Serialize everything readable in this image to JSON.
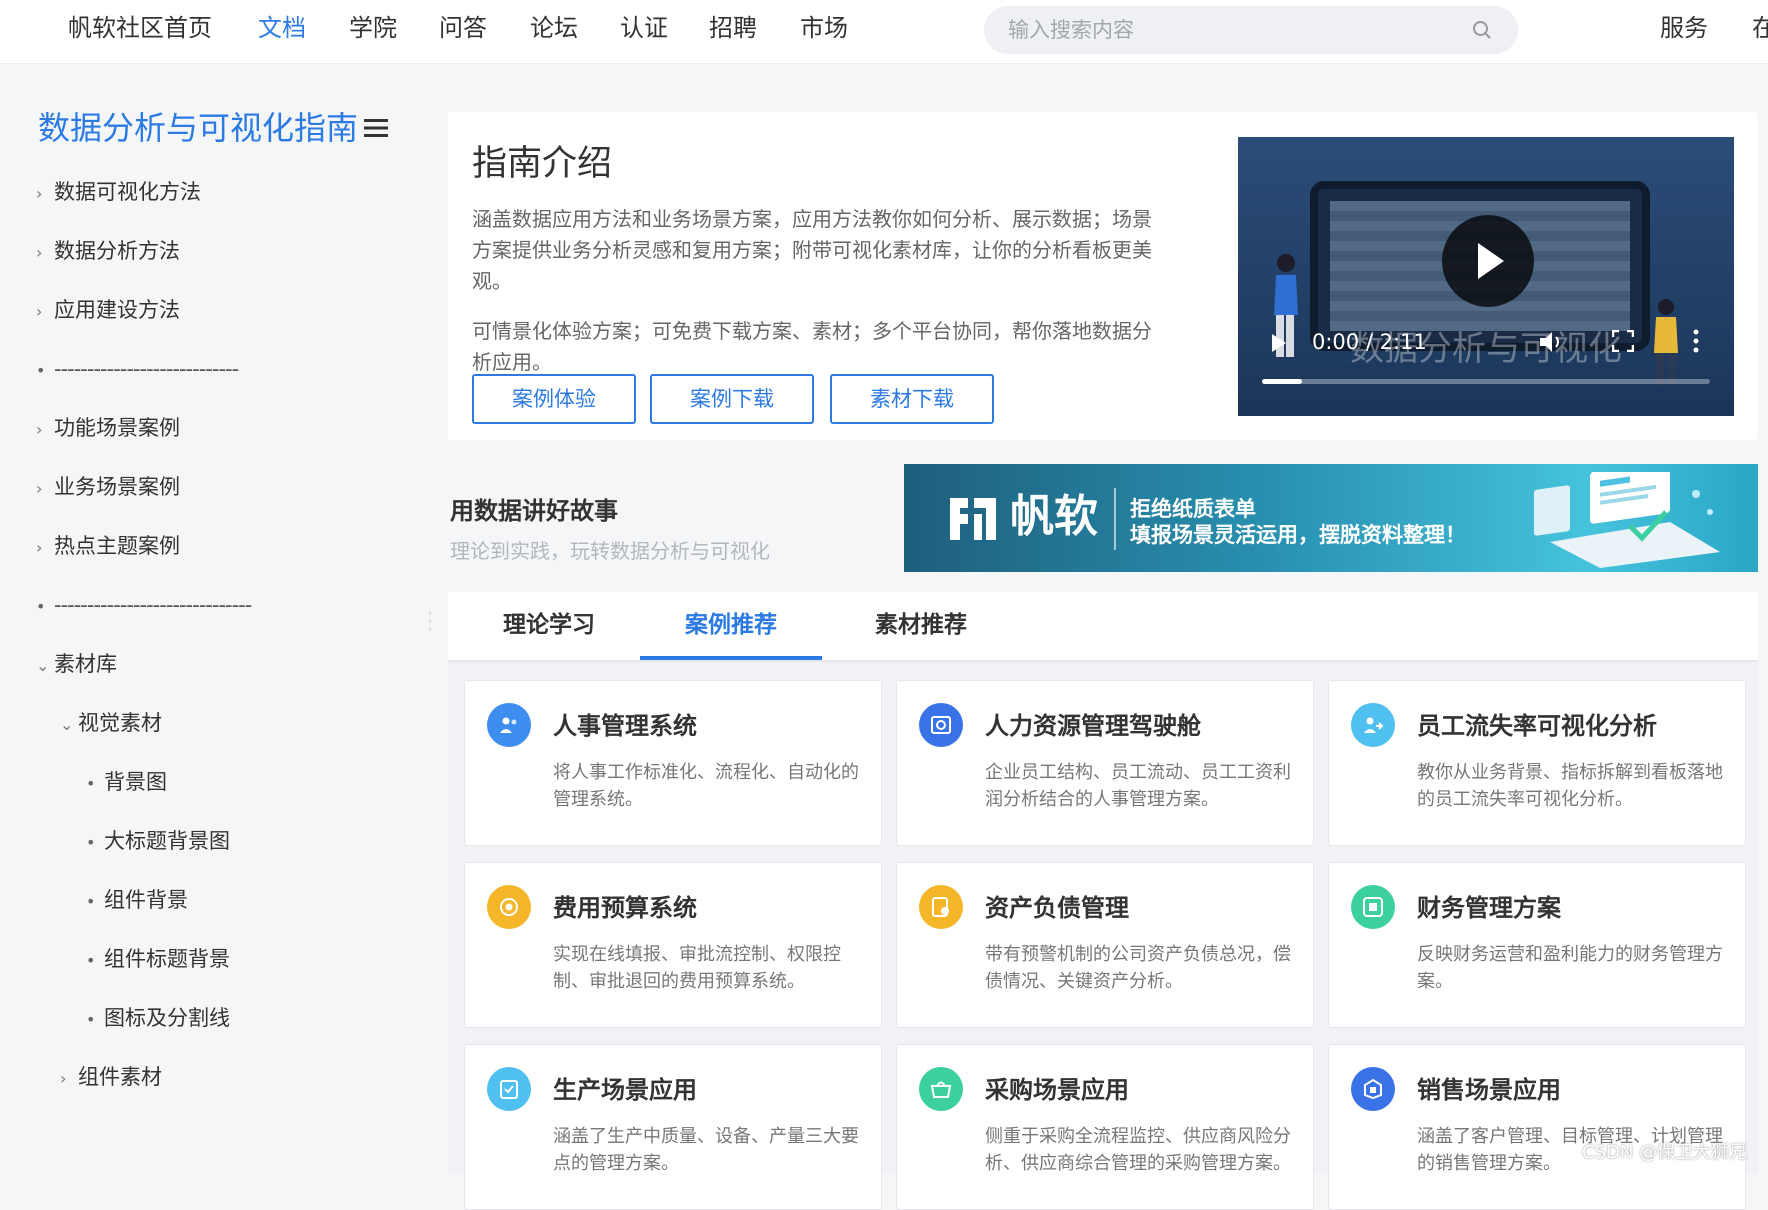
{
  "topnav": {
    "items": [
      {
        "label": "帆软社区首页"
      },
      {
        "label": "文档"
      },
      {
        "label": "学院"
      },
      {
        "label": "问答"
      },
      {
        "label": "论坛"
      },
      {
        "label": "认证"
      },
      {
        "label": "招聘"
      },
      {
        "label": "市场"
      }
    ],
    "active_index": 1,
    "search_placeholder": "输入搜索内容",
    "service_label": "服务",
    "cut_label": "在"
  },
  "sidebar": {
    "title": "数据分析与可视化指南",
    "items": [
      {
        "label": "数据可视化方法",
        "marker": "chevron-right"
      },
      {
        "label": "数据分析方法",
        "marker": "chevron-right"
      },
      {
        "label": "应用建设方法",
        "marker": "chevron-right"
      },
      {
        "label": "----------------------------",
        "marker": "dot"
      },
      {
        "label": "功能场景案例",
        "marker": "chevron-right"
      },
      {
        "label": "业务场景案例",
        "marker": "chevron-right"
      },
      {
        "label": "热点主题案例",
        "marker": "chevron-right"
      },
      {
        "label": "------------------------------",
        "marker": "dot"
      },
      {
        "label": "素材库",
        "marker": "chevron-down"
      },
      {
        "label": "视觉素材",
        "marker": "chevron-down"
      },
      {
        "label": "背景图",
        "marker": "dot"
      },
      {
        "label": "大标题背景图",
        "marker": "dot"
      },
      {
        "label": "组件背景",
        "marker": "dot"
      },
      {
        "label": "组件标题背景",
        "marker": "dot"
      },
      {
        "label": "图标及分割线",
        "marker": "dot"
      },
      {
        "label": "组件素材",
        "marker": "chevron-right"
      }
    ]
  },
  "intro": {
    "title": "指南介绍",
    "para1": "涵盖数据应用方法和业务场景方案，应用方法教你如何分析、展示数据；场景方案提供业务分析灵感和复用方案；附带可视化素材库，让你的分析看板更美观。",
    "para2": "可情景化体验方案；可免费下载方案、素材；多个平台协同，帮你落地数据分析应用。",
    "buttons": [
      {
        "label": "案例体验"
      },
      {
        "label": "案例下载"
      },
      {
        "label": "素材下载"
      }
    ]
  },
  "video": {
    "time": "0:00 / 2:11",
    "overlay_text": "数据分析与可视化",
    "progress": 0.09
  },
  "story": {
    "title": "用数据讲好故事",
    "subtitle": "理论到实践，玩转数据分析与可视化"
  },
  "banner": {
    "logo_text": "帆软",
    "line1": "拒绝纸质表单",
    "line2": "填报场景灵活运用，摆脱资料整理！"
  },
  "tabs": {
    "items": [
      {
        "label": "理论学习"
      },
      {
        "label": "案例推荐"
      },
      {
        "label": "素材推荐"
      }
    ],
    "active_index": 1
  },
  "cases": [
    {
      "title": "人事管理系统",
      "desc": "将人事工作标准化、流程化、自动化的管理系统。",
      "icon": "user-group-icon",
      "color": "#3d8ef0"
    },
    {
      "title": "人力资源管理驾驶舱",
      "desc": "企业员工结构、员工流动、员工工资利润分析结合的人事管理方案。",
      "icon": "dashboard-icon",
      "color": "#3a72e8"
    },
    {
      "title": "员工流失率可视化分析",
      "desc": "教你从业务背景、指标拆解到看板落地的员工流失率可视化分析。",
      "icon": "user-leave-icon",
      "color": "#4fc0ef"
    },
    {
      "title": "费用预算系统",
      "desc": "实现在线填报、审批流控制、权限控制、审批退回的费用预算系统。",
      "icon": "coin-icon",
      "color": "#f5b62a"
    },
    {
      "title": "资产负债管理",
      "desc": "带有预警机制的公司资产负债总况，偿债情况、关键资产分析。",
      "icon": "ledger-icon",
      "color": "#f5b62a"
    },
    {
      "title": "财务管理方案",
      "desc": "反映财务运营和盈利能力的财务管理方案。",
      "icon": "finance-icon",
      "color": "#3ccfa0"
    },
    {
      "title": "生产场景应用",
      "desc": "涵盖了生产中质量、设备、产量三大要点的管理方案。",
      "icon": "clipboard-icon",
      "color": "#4fc0ef"
    },
    {
      "title": "采购场景应用",
      "desc": "侧重于采购全流程监控、供应商风险分析、供应商综合管理的采购管理方案。",
      "icon": "basket-icon",
      "color": "#3ccfa0"
    },
    {
      "title": "销售场景应用",
      "desc": "涵盖了客户管理、目标管理、计划管理的销售管理方案。",
      "icon": "sales-icon",
      "color": "#3a72e8"
    }
  ],
  "watermark": "CSDN @保卫大狮兄"
}
